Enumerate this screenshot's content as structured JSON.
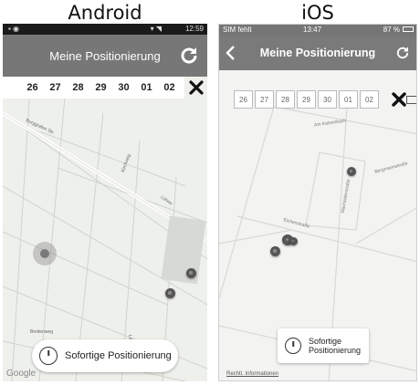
{
  "captions": {
    "android": "Android",
    "ios": "iOS"
  },
  "android": {
    "status": {
      "time": "12:59"
    },
    "title": "Meine Positionierung",
    "days": [
      "26",
      "27",
      "28",
      "29",
      "30",
      "01",
      "02"
    ],
    "button": "Sofortige Positionierung",
    "streets": [
      {
        "label": "Burggrafen Str."
      },
      {
        "label": "Kirchweg"
      },
      {
        "label": "Lührer"
      },
      {
        "label": "Breitenweg"
      },
      {
        "label": "Lindenweg"
      }
    ],
    "google": "Google"
  },
  "ios": {
    "status": {
      "carrier": "SIM fehlt",
      "time": "13:47",
      "battery": "87 %"
    },
    "title": "Meine Positionierung",
    "days": [
      "26",
      "27",
      "28",
      "29",
      "30",
      "01",
      "02"
    ],
    "button_line1": "Sofortige",
    "button_line2": "Positionierung",
    "streets": [
      {
        "label": "Am Katzenbach"
      },
      {
        "label": "Bergmannstraße"
      },
      {
        "label": "Wacholderstraße"
      },
      {
        "label": "Eichenstraße"
      }
    ],
    "legal": "Rechtl. Informationen"
  },
  "colors": {
    "appbar": "#777777",
    "pin": "#555555"
  }
}
